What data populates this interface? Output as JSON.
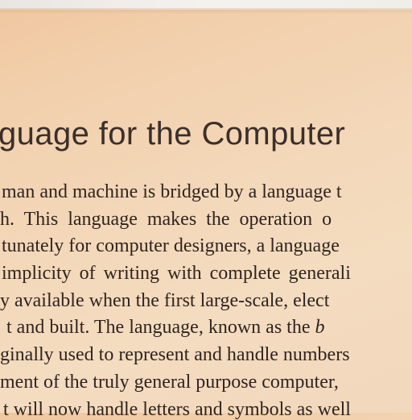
{
  "heading": "guage for the Computer",
  "paragraph": {
    "line1": "man and machine is bridged by a language t",
    "line2": "h. This language makes the operation o",
    "line3": "tunately for computer designers, a language",
    "line4": "implicity of writing with complete generali",
    "line5": "y available when the first large-scale, elect",
    "line6a": "t and built. The language, known as the ",
    "line6b": "b",
    "line7": "ginally used to represent and handle numbers",
    "line8": "ment of the truly general purpose computer,",
    "line9": "t will now handle letters and symbols as well"
  }
}
